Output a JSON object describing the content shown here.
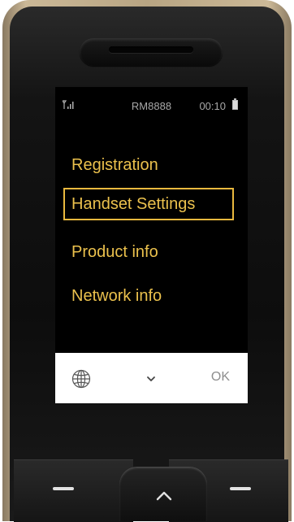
{
  "status_bar": {
    "signal_icon": "signal-strength-icon",
    "operator": "RM8888",
    "time": "00:10",
    "battery_icon": "battery-icon"
  },
  "menu": {
    "items": [
      {
        "label": "Registration",
        "selected": false
      },
      {
        "label": "Handset Settings",
        "selected": true
      },
      {
        "label": "Product info",
        "selected": false
      },
      {
        "label": "Network info",
        "selected": false
      }
    ],
    "accent_color": "#ebc14d"
  },
  "softkeys": {
    "left_icon": "globe-icon",
    "center_icon": "chevron-down-icon",
    "right_label": "OK"
  },
  "hardware_keys": {
    "left": "left-softkey",
    "nav": "nav-up-key",
    "right": "right-softkey"
  }
}
